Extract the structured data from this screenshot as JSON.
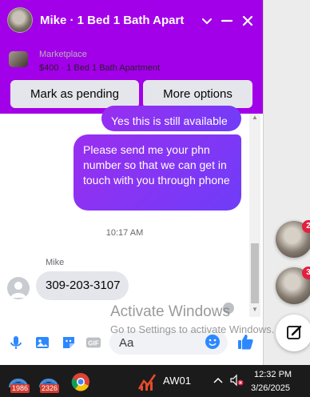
{
  "chat": {
    "title": "Mike · 1 Bed 1 Bath Apart",
    "marketplace_label": "Marketplace",
    "listing": "$400 · 1 Bed 1 Bath Apartment",
    "mark_pending_label": "Mark as pending",
    "more_options_label": "More options",
    "messages_out": [
      "Yes this is still available",
      "Please send me your phn number so that we can get in touch with you through phone"
    ],
    "timestamp": "10:17 AM",
    "sender_name": "Mike",
    "message_in": "309-203-3107",
    "composer_placeholder": "Aa",
    "accent_color": "#a200e8"
  },
  "watermark": {
    "line1": "Activate Windows",
    "line2": "Go to Settings to activate Windows."
  },
  "chat_heads": [
    {
      "badge": "2"
    },
    {
      "badge": "3"
    }
  ],
  "taskbar": {
    "apps": [
      {
        "badge": "1986"
      },
      {
        "badge": "2326"
      }
    ],
    "app_label": "AW01",
    "time": "12:32 PM",
    "date": "3/26/2025"
  }
}
